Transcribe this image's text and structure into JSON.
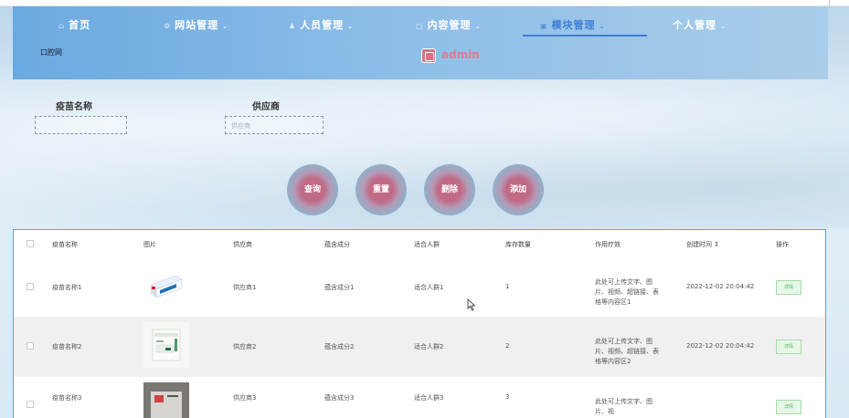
{
  "nav": {
    "items": [
      {
        "label": "首页",
        "icon": "home-icon",
        "has_caret": false
      },
      {
        "label": "网站管理",
        "icon": "settings-icon",
        "has_caret": true
      },
      {
        "label": "人员管理",
        "icon": "user-icon",
        "has_caret": true
      },
      {
        "label": "内容管理",
        "icon": "document-icon",
        "has_caret": true
      },
      {
        "label": "模块管理",
        "icon": "module-icon",
        "has_caret": true,
        "active": true
      },
      {
        "label": "个人管理",
        "icon": "person-icon",
        "has_caret": true
      }
    ],
    "active_color": "#3f7fd6"
  },
  "header": {
    "logo_text": "口腔网",
    "user": "admin"
  },
  "filters": {
    "vaccine_label": "疫苗名称",
    "vaccine_placeholder": "",
    "supplier_label": "供应商",
    "supplier_placeholder": "供应商"
  },
  "buttons": {
    "search": "查询",
    "reset": "重置",
    "delete": "删除",
    "add": "添加"
  },
  "table": {
    "columns": [
      "疫苗名称",
      "图片",
      "供应商",
      "蕴含成分",
      "适合人群",
      "库存数量",
      "作用疗效",
      "创建时间 ↕",
      "操作"
    ],
    "rows": [
      {
        "name": "疫苗名称1",
        "supplier": "供应商1",
        "ingredient": "蕴含成分1",
        "crowd": "适合人群1",
        "stock": "1",
        "effect": "此处可上传文字、图片、视频、超链接、表格等内容区1",
        "created": "2022-12-02 20:04:42",
        "action": "详情"
      },
      {
        "name": "疫苗名称2",
        "supplier": "供应商2",
        "ingredient": "蕴含成分2",
        "crowd": "适合人群2",
        "stock": "2",
        "effect": "此处可上传文字、图片、视频、超链接、表格等内容区2",
        "created": "2022-12-02 20:04:42",
        "action": "详情"
      },
      {
        "name": "疫苗名称3",
        "supplier": "供应商3",
        "ingredient": "蕴含成分3",
        "crowd": "适合人群3",
        "stock": "3",
        "effect": "此处可上传文字、图片、视",
        "created": "",
        "action": "详情"
      }
    ]
  },
  "colors": {
    "table_border": "#5ba2d9",
    "detail_btn": "#54b45c",
    "admin": "#e47a8d"
  }
}
